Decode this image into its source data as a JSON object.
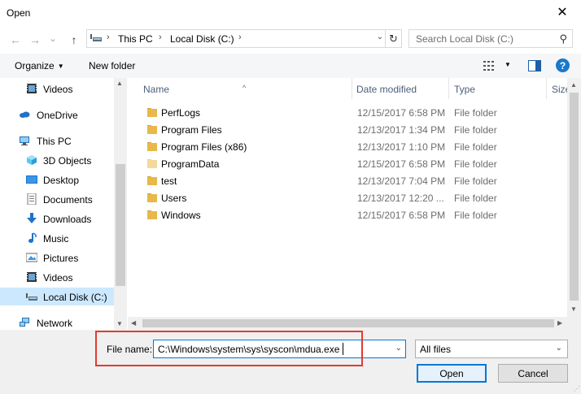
{
  "window": {
    "title": "Open",
    "close_glyph": "✕"
  },
  "nav": {
    "back_glyph": "←",
    "forward_glyph": "→",
    "recent_glyph": "⌄",
    "up_glyph": "↑",
    "breadcrumbs": [
      "This PC",
      "Local Disk (C:)"
    ],
    "crumb_sep": "›",
    "dropdown_glyph": "⌄",
    "refresh_glyph": "↻",
    "search_placeholder": "Search Local Disk (C:)",
    "search_glyph": "⚲"
  },
  "toolbar": {
    "organize_label": "Organize",
    "caret": "▼",
    "new_folder_label": "New folder",
    "view_caret": "▼",
    "help_label": "?"
  },
  "sidebar": {
    "items": [
      {
        "label": "Videos",
        "icon": "videos-icon",
        "indent": 2
      },
      {
        "label": "OneDrive",
        "icon": "onedrive-icon",
        "indent": 1
      },
      {
        "label": "This PC",
        "icon": "this-pc-icon",
        "indent": 1
      },
      {
        "label": "3D Objects",
        "icon": "3d-objects-icon",
        "indent": 2
      },
      {
        "label": "Desktop",
        "icon": "desktop-icon",
        "indent": 2
      },
      {
        "label": "Documents",
        "icon": "documents-icon",
        "indent": 2
      },
      {
        "label": "Downloads",
        "icon": "downloads-icon",
        "indent": 2
      },
      {
        "label": "Music",
        "icon": "music-icon",
        "indent": 2
      },
      {
        "label": "Pictures",
        "icon": "pictures-icon",
        "indent": 2
      },
      {
        "label": "Videos",
        "icon": "videos-icon",
        "indent": 2
      },
      {
        "label": "Local Disk (C:)",
        "icon": "drive-icon",
        "indent": 2,
        "selected": true
      },
      {
        "label": "Network",
        "icon": "network-icon",
        "indent": 1
      }
    ],
    "scroll_up": "▲",
    "scroll_down": "▼"
  },
  "columns": {
    "name": "Name",
    "date": "Date modified",
    "type": "Type",
    "size": "Size",
    "sort_glyph": "^"
  },
  "files": [
    {
      "name": "PerfLogs",
      "date": "12/15/2017 6:58 PM",
      "type": "File folder"
    },
    {
      "name": "Program Files",
      "date": "12/13/2017 1:34 PM",
      "type": "File folder"
    },
    {
      "name": "Program Files (x86)",
      "date": "12/13/2017 1:10 PM",
      "type": "File folder"
    },
    {
      "name": "ProgramData",
      "date": "12/15/2017 6:58 PM",
      "type": "File folder",
      "hidden": true
    },
    {
      "name": "test",
      "date": "12/13/2017 7:04 PM",
      "type": "File folder"
    },
    {
      "name": "Users",
      "date": "12/13/2017 12:20 ...",
      "type": "File folder"
    },
    {
      "name": "Windows",
      "date": "12/15/2017 6:58 PM",
      "type": "File folder"
    }
  ],
  "scroll": {
    "up": "▲",
    "down": "▼",
    "left": "◀",
    "right": "▶"
  },
  "footer": {
    "file_name_label": "File name:",
    "file_name_value": "C:\\Windows\\system\\sys\\syscon\\mdua.exe",
    "dropdown_glyph": "⌄",
    "filter_value": "All files",
    "open_label": "Open",
    "cancel_label": "Cancel",
    "grip": "⋰"
  },
  "colors": {
    "accent": "#0078d7",
    "selection": "#cce8ff",
    "highlight_box": "#e03c31",
    "folder": "#e8b84a",
    "folder_hidden": "#f3d99a"
  }
}
